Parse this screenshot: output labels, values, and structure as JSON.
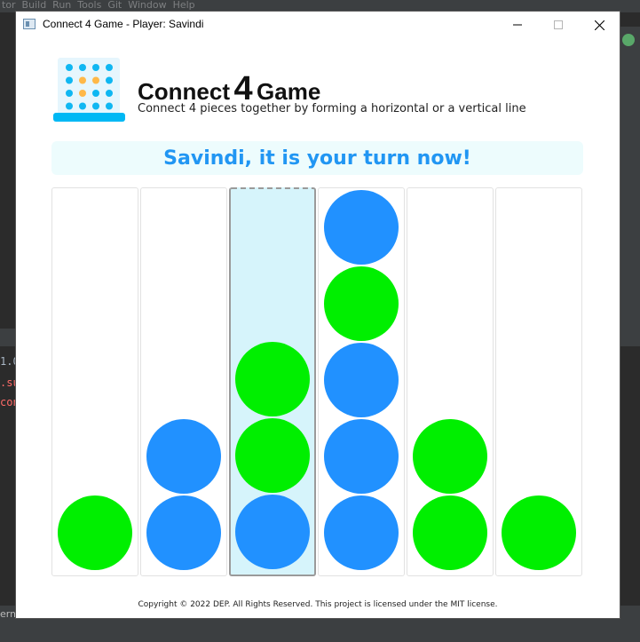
{
  "window": {
    "title": "Connect 4 Game - Player: Savindi"
  },
  "header": {
    "title_before": "Connect",
    "title_number": "4",
    "title_after": "Game",
    "subtitle": "Connect 4 pieces together by forming a horizontal or a vertical line"
  },
  "status": {
    "message": "Savindi, it is your turn now!"
  },
  "board": {
    "columns": 6,
    "rows": 5,
    "highlighted_column": 2,
    "colors": {
      "player1": "#2191ff",
      "player2": "#00ef00"
    },
    "pieces_bottom_up": [
      [
        "player2"
      ],
      [
        "player1",
        "player1"
      ],
      [
        "player1",
        "player2",
        "player2"
      ],
      [
        "player1",
        "player1",
        "player1",
        "player2",
        "player1"
      ],
      [
        "player2",
        "player2"
      ],
      [
        "player2"
      ]
    ]
  },
  "footer": {
    "copyright": "Copyright © 2022 DEP. All Rights Reserved. This project is licensed under the MIT license."
  },
  "theme": {
    "accent": "#2196f3",
    "banner_bg": "#edfcfd",
    "hover_column_bg": "#d6f4fb",
    "logo_base": "#00b8f4"
  }
}
